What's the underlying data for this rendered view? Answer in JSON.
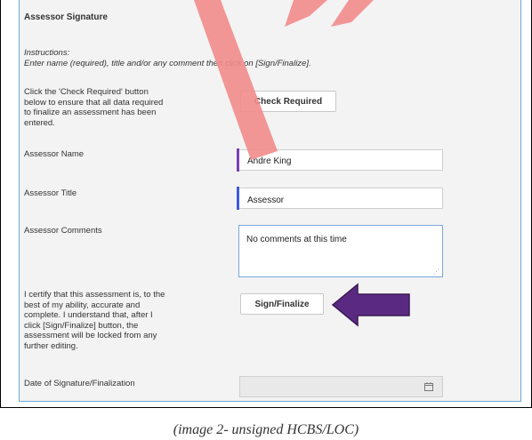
{
  "section": {
    "title": "Assessor Signature",
    "instructions_line1": "Instructions:",
    "instructions_line2": "Enter name (required), title and/or any comment then click on [Sign/Finalize]."
  },
  "check_required": {
    "label_lines": [
      "Click the 'Check Required' button",
      "below to ensure that all data required",
      "to finalize an assessment has been",
      "entered."
    ],
    "button": "Check Required"
  },
  "assessor_name": {
    "label": "Assessor Name",
    "value": "Andre King"
  },
  "assessor_title": {
    "label": "Assessor Title",
    "value": "Assessor"
  },
  "assessor_comments": {
    "label": "Assessor Comments",
    "value": "No comments at this time"
  },
  "certify": {
    "label_lines": [
      "I certify that this assessment is, to the",
      "best of my ability, accurate and",
      "complete. I understand that, after I",
      "click [Sign/Finalize] button, the",
      "assessment will be locked from any",
      "further editing."
    ],
    "button": "Sign/Finalize"
  },
  "date_field": {
    "label": "Date of Signature/Finalization",
    "value": ""
  },
  "caption": "(image 2- unsigned HCBS/LOC)",
  "colors": {
    "required_bar": "#7a3fb4",
    "title_bar": "#3a5bd9",
    "arrow": "#5a2a82",
    "stamp": "#f28b8b"
  }
}
